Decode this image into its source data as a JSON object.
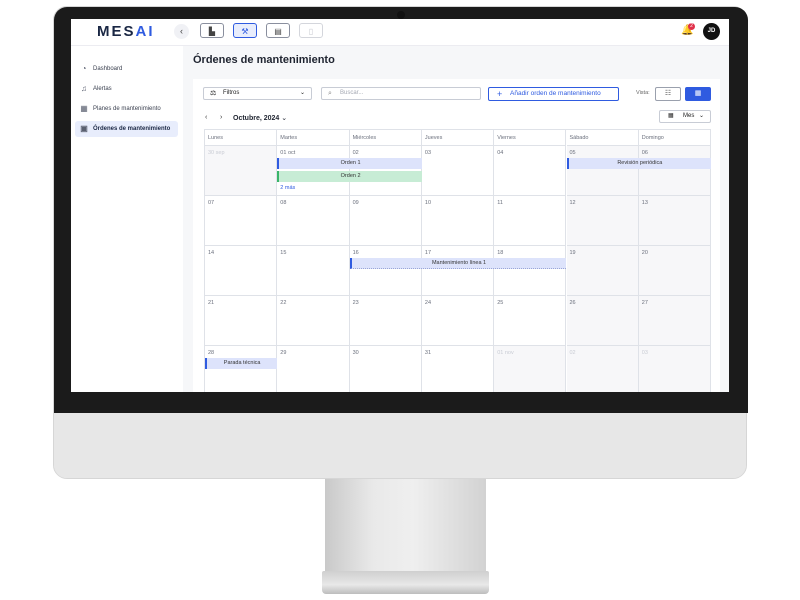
{
  "app": {
    "logo_main": "MES",
    "logo_accent": "AI",
    "collapse_icon": "chevron-left-icon",
    "modules": [
      {
        "name": "factory-icon",
        "glyph": "▙"
      },
      {
        "name": "wrench-icon",
        "glyph": "🔧"
      },
      {
        "name": "monitor-icon",
        "glyph": "▤"
      },
      {
        "name": "document-icon",
        "glyph": "▯"
      }
    ],
    "notifications_count": "2",
    "user_initials": "JD"
  },
  "sidebar": {
    "items": [
      {
        "label": "Dashboard",
        "icon": "gauge-icon",
        "glyph": "◔"
      },
      {
        "label": "Alertas",
        "icon": "bell-icon",
        "glyph": "🔔"
      },
      {
        "label": "Planes de mantenimiento",
        "icon": "calendar-icon",
        "glyph": "▦"
      },
      {
        "label": "Órdenes de mantenimiento",
        "icon": "clipboard-icon",
        "glyph": "▣"
      }
    ]
  },
  "page": {
    "title": "Órdenes de mantenimiento"
  },
  "toolbar": {
    "filters_label": "Filtros",
    "search_placeholder": "Buscar...",
    "add_label": "Añadir orden de mantenimiento",
    "view_label": "Vista:"
  },
  "calendar": {
    "month_label": "Octubre, 2024",
    "view_mode": "Mes",
    "weekdays": [
      "Lunes",
      "Martes",
      "Miércoles",
      "Jueves",
      "Viernes",
      "Sábado",
      "Domingo"
    ],
    "weeks": [
      [
        "30 sep",
        "01 oct",
        "02",
        "03",
        "04",
        "05",
        "06"
      ],
      [
        "07",
        "08",
        "09",
        "10",
        "11",
        "12",
        "13"
      ],
      [
        "14",
        "15",
        "16",
        "17",
        "18",
        "19",
        "20"
      ],
      [
        "21",
        "22",
        "23",
        "24",
        "25",
        "26",
        "27"
      ],
      [
        "28",
        "29",
        "30",
        "31",
        "01 nov",
        "02",
        "03"
      ]
    ],
    "events": [
      {
        "title": "Orden 1",
        "week": 0,
        "start": 1,
        "span": 2,
        "lane": 0,
        "color": "blue"
      },
      {
        "title": "Orden 2",
        "week": 0,
        "start": 1,
        "span": 2,
        "lane": 1,
        "color": "green"
      },
      {
        "title": "Revisión periódica",
        "week": 0,
        "start": 5,
        "span": 2,
        "lane": 0,
        "color": "blue"
      },
      {
        "title": "Mantenimiento línea 1",
        "week": 2,
        "start": 2,
        "span": 3,
        "lane": 0,
        "color": "blue"
      },
      {
        "title": "Parada técnica",
        "week": 4,
        "start": 0,
        "span": 1,
        "lane": 0,
        "color": "blue"
      }
    ],
    "more_links": [
      {
        "label": "2 más",
        "week": 0,
        "day": 1
      }
    ]
  },
  "colors": {
    "accent": "#2f5be0",
    "event_blue": "#dde3fb",
    "event_green": "#c7ecd5"
  }
}
